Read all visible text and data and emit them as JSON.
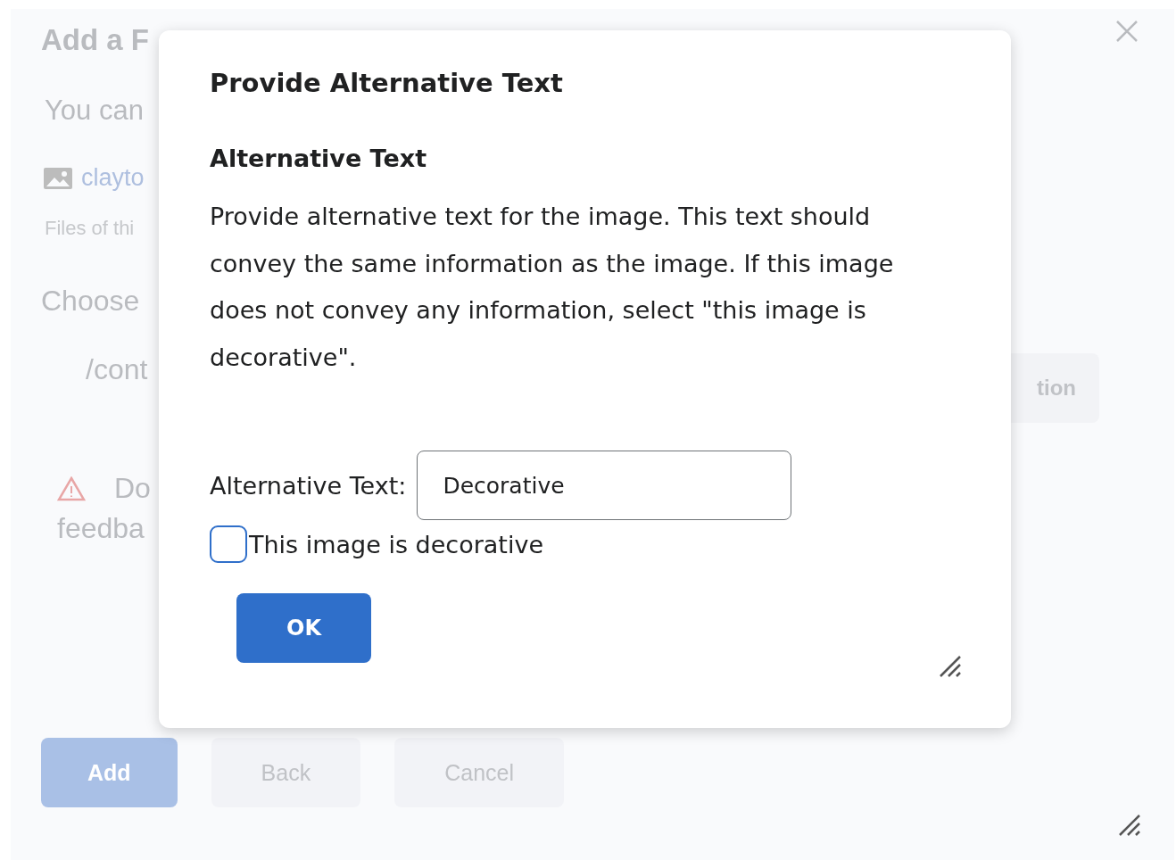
{
  "background_dialog": {
    "title": "Add a F",
    "intro": "You can",
    "file_link": "clayto",
    "file_note": "Files of thi",
    "section_label": "Choose",
    "path_value": "/cont",
    "side_button": "tion",
    "warning_lines": [
      "Do",
      "feedba"
    ],
    "buttons": [
      {
        "label": "Add",
        "kind": "primary"
      },
      {
        "label": "Back",
        "kind": "secondary"
      },
      {
        "label": "Cancel",
        "kind": "secondary"
      }
    ]
  },
  "modal": {
    "title": "Provide Alternative Text",
    "section_heading": "Alternative Text",
    "description": "Provide alternative text for the image. This text should convey the same information as the image. If this image does not convey any information, select \"this image is decorative\".",
    "field": {
      "label": "Alternative Text:",
      "value": "Decorative"
    },
    "checkbox": {
      "label": "This image is decorative",
      "checked": false
    },
    "ok_button": "OK"
  }
}
